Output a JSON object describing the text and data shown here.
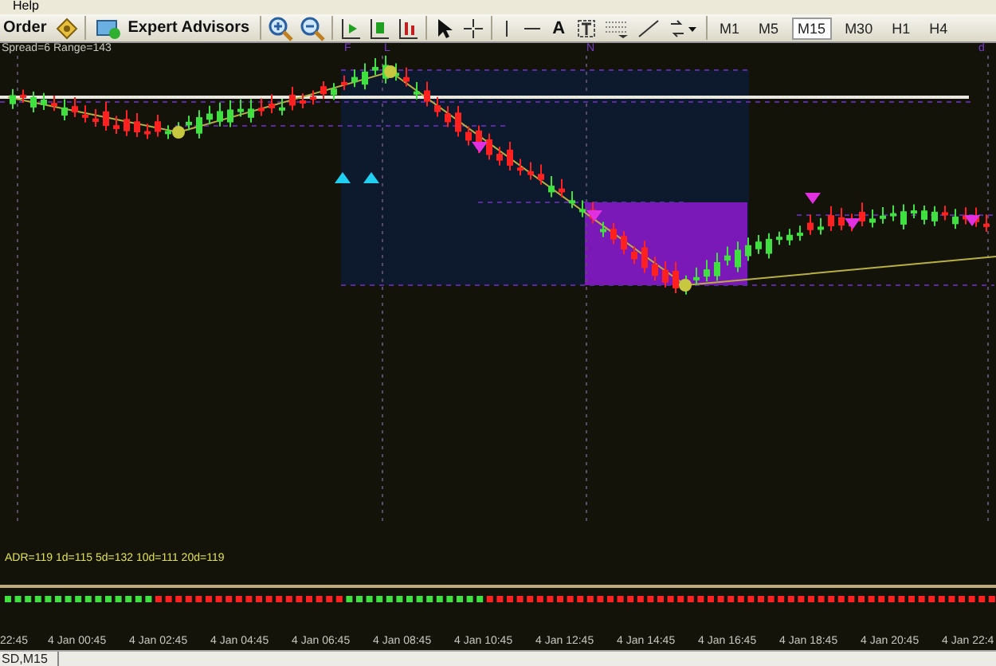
{
  "menu": {
    "items": [
      {
        "label": "Help"
      }
    ]
  },
  "toolbar": {
    "order_button": "Order",
    "expert_advisors_button": "Expert Advisors",
    "text_tool": "A",
    "timeframes": [
      {
        "label": "M1",
        "selected": false
      },
      {
        "label": "M5",
        "selected": false
      },
      {
        "label": "M15",
        "selected": true
      },
      {
        "label": "M30",
        "selected": false
      },
      {
        "label": "H1",
        "selected": false
      },
      {
        "label": "H4",
        "selected": false
      }
    ]
  },
  "chart": {
    "info": "Spread=6  Range=143",
    "markers": [
      {
        "label": "F"
      },
      {
        "label": "L"
      },
      {
        "label": "N"
      },
      {
        "label": "d"
      }
    ],
    "adr": "ADR=119  1d=115  5d=132  10d=111  20d=119",
    "time_labels": [
      "22:45",
      "4 Jan 00:45",
      "4 Jan 02:45",
      "4 Jan 04:45",
      "4 Jan 06:45",
      "4 Jan 08:45",
      "4 Jan 10:45",
      "4 Jan 12:45",
      "4 Jan 14:45",
      "4 Jan 16:45",
      "4 Jan 18:45",
      "4 Jan 20:45",
      "4 Jan 22:4"
    ]
  },
  "status_bar": {
    "tab": "SD,M15"
  }
}
